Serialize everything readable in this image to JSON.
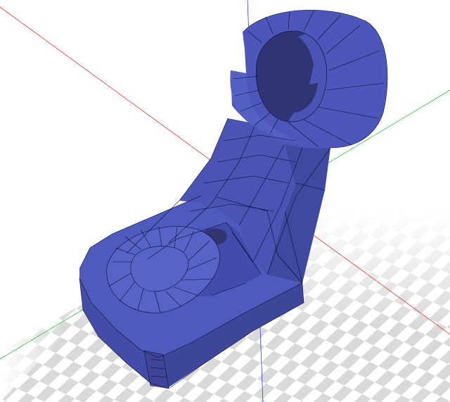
{
  "viewer": {
    "background": "#ffffff",
    "axes": {
      "x_color": "#e53b3b",
      "y_color": "#2fbf3b",
      "z_color": "#3b3bff"
    },
    "build_plate": {
      "checker_light": "#ffffff",
      "checker_dark": "#d9d9d9"
    },
    "model": {
      "fill_color": "#4b55b6",
      "fill_light": "#5a64c8",
      "fill_dark": "#3e4698",
      "wire_color": "#06082a",
      "display_mode": "wireframe-shaded"
    }
  }
}
